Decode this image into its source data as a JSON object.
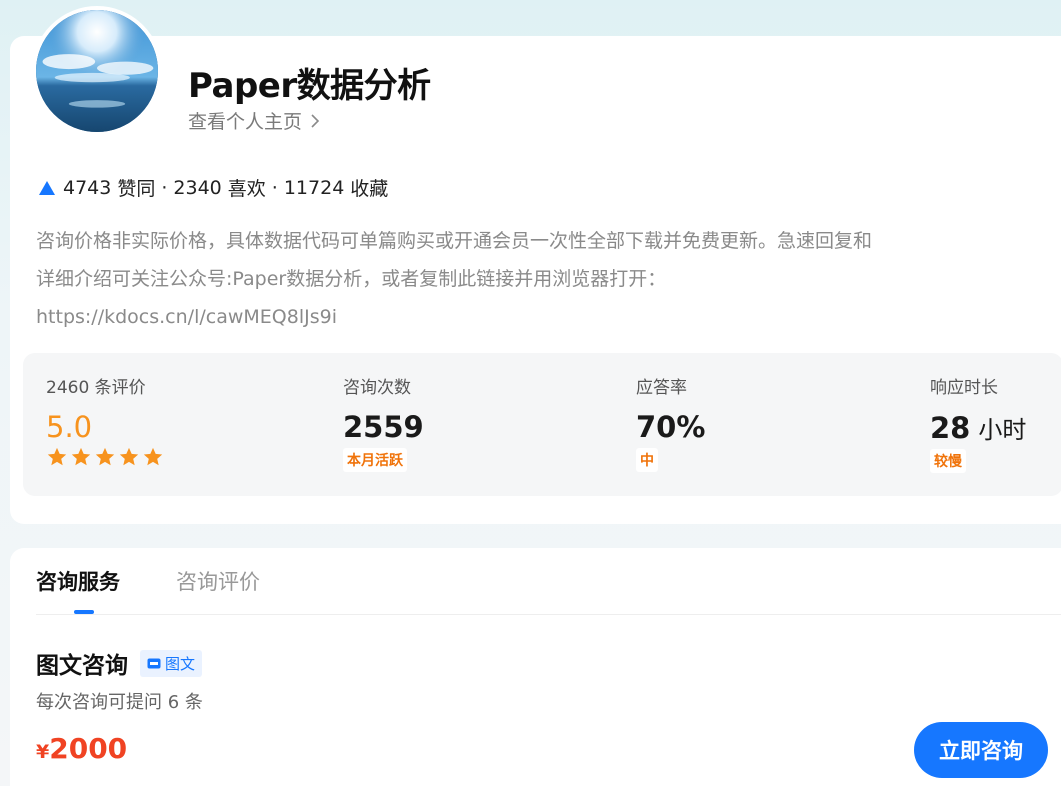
{
  "profile": {
    "name": "Paper数据分析",
    "homepage_link": "查看个人主页",
    "stats": {
      "agree_count": "4743",
      "agree_label": "赞同",
      "like_count": "2340",
      "like_label": "喜欢",
      "collect_count": "11724",
      "collect_label": "收藏",
      "separator": "·"
    },
    "intro_lines": [
      "咨询价格非实际价格，具体数据代码可单篇购买或开通会员一次性全部下载并免费更新。急速回复和",
      "详细介绍可关注公众号:Paper数据分析，或者复制此链接并用浏览器打开：",
      "https://kdocs.cn/l/cawMEQ8lJs9i"
    ]
  },
  "metrics": {
    "reviews": {
      "label": "2460 条评价",
      "value": "5.0",
      "stars": 5
    },
    "consults": {
      "label": "咨询次数",
      "value": "2559",
      "tag": "本月活跃"
    },
    "response_rate": {
      "label": "应答率",
      "value": "70%",
      "tag": "中"
    },
    "response_time": {
      "label": "响应时长",
      "value": "28",
      "unit": "小时",
      "tag": "较慢"
    }
  },
  "tabs": [
    {
      "label": "咨询服务",
      "active": true
    },
    {
      "label": "咨询评价",
      "active": false
    }
  ],
  "service": {
    "title": "图文咨询",
    "badge": "图文",
    "description": "每次咨询可提问 6 条",
    "currency": "¥",
    "price": "2000",
    "button": "立即咨询"
  },
  "colors": {
    "accent": "#1677ff",
    "rating": "#f7931e",
    "price": "#f04323",
    "tag": "#f0730a"
  },
  "icons": [
    "avatar-image",
    "chevron-right-icon",
    "agree-triangle-icon",
    "star-icon",
    "image-icon"
  ]
}
